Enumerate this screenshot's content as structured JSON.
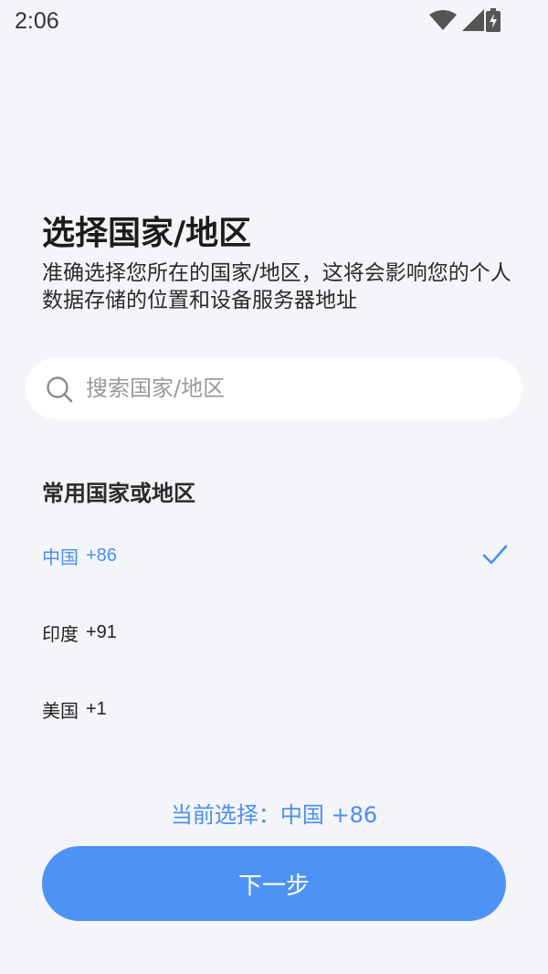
{
  "status_bar": {
    "time": "2:06",
    "icons": [
      "wifi-icon",
      "signal-icon",
      "battery-charging-icon"
    ]
  },
  "header": {
    "title": "选择国家/地区",
    "description": "准确选择您所在的国家/地区，这将会影响您的个人数据存储的位置和设备服务器地址"
  },
  "search": {
    "placeholder": "搜索国家/地区",
    "value": ""
  },
  "section": {
    "title": "常用国家或地区"
  },
  "countries": [
    {
      "name": "中国",
      "code": "+86",
      "selected": true
    },
    {
      "name": "印度",
      "code": "+91",
      "selected": false
    },
    {
      "name": "美国",
      "code": "+1",
      "selected": false
    }
  ],
  "current_selection": "当前选择：中国 +86",
  "next_button": {
    "label": "下一步"
  },
  "colors": {
    "accent": "#4d93f6",
    "selected_text": "#4b8ef0",
    "background": "#f4f5f9"
  }
}
